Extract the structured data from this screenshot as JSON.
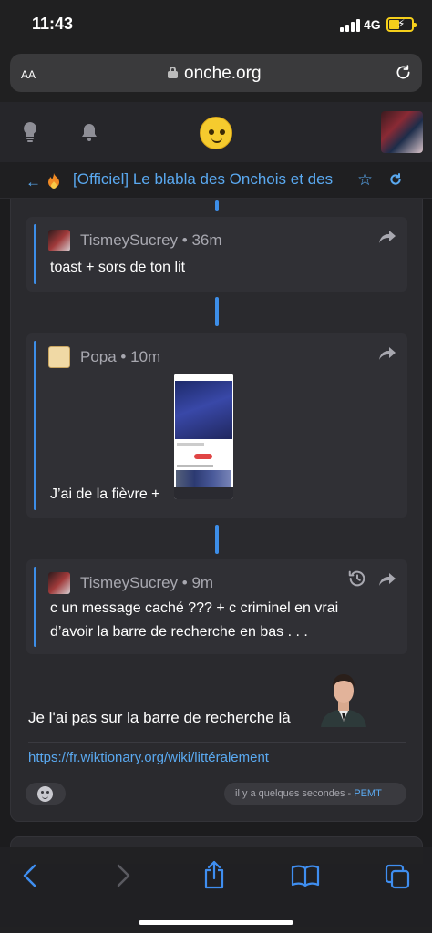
{
  "status_bar": {
    "time": "11:43",
    "network": "4G"
  },
  "browser": {
    "text_size_label": "AA",
    "domain": "onche.org"
  },
  "topic": {
    "title": "[Officiel] Le blabla des Onchois et des"
  },
  "quotes": [
    {
      "author": "TismeySucrey",
      "sep": " • ",
      "time": "36m",
      "text": "toast + sors de ton lit"
    },
    {
      "author": "Popa",
      "sep": " • ",
      "time": "10m",
      "text": "J’ai de la fièvre +"
    },
    {
      "author": "TismeySucrey",
      "sep": " • ",
      "time": "9m",
      "text_line1": "c un message caché ??? + c criminel en vrai",
      "text_line2": "d’avoir la barre de recherche en bas . . ."
    }
  ],
  "message": {
    "text": "Je l'ai pas sur la barre de recherche là",
    "link": "https://fr.wiktionary.org/wiki/littéralement",
    "timestamp": "il y a quelques secondes",
    "dash": " - ",
    "author": "PEMT"
  },
  "icons": [
    "lightbulb-icon",
    "bell-icon",
    "smiley-logo",
    "back-arrow-icon",
    "fire-icon",
    "star-icon",
    "refresh-icon",
    "share-icon",
    "history-icon",
    "emoji-react-icon",
    "back-chevron-icon",
    "forward-chevron-icon",
    "share-sheet-icon",
    "bookmarks-icon",
    "tabs-icon"
  ],
  "colors": {
    "accent": "#5aa9f0",
    "quote_bar": "#3d8ee8",
    "background": "#1c1c1e",
    "card": "#2a2a2e",
    "battery": "#f5cf1b"
  }
}
